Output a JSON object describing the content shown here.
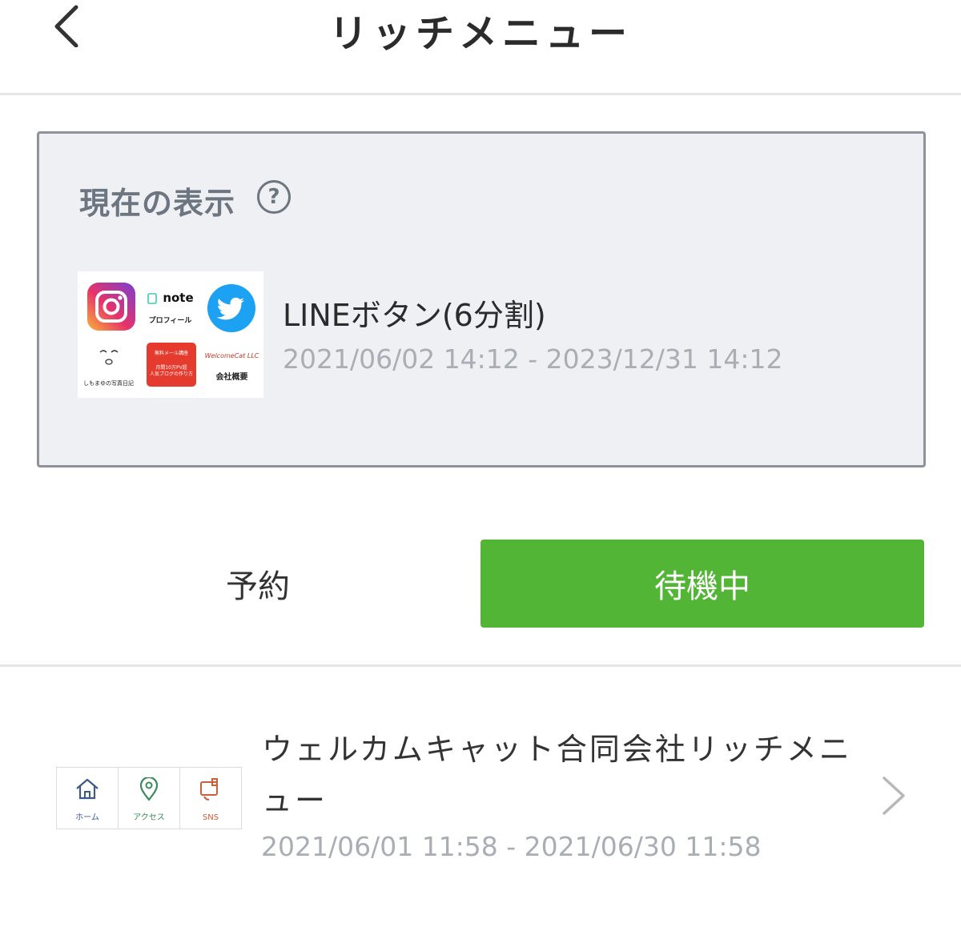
{
  "header": {
    "title": "リッチメニュー",
    "back_icon": "chevron-left-icon"
  },
  "current": {
    "label": "現在の表示",
    "help_icon_text": "?",
    "menu_name": "LINEボタン(6分割)",
    "period": "2021/06/02 14:12 - 2023/12/31 14:12",
    "thumbnail": {
      "note_label": "note",
      "note_sub": "プロフィール",
      "photo_diary": "しもまゆの写真日記",
      "red_line1": "無料メール講座",
      "red_line2": "月間10万PV超",
      "red_line3": "人気ブログの作り方",
      "company_logo": "WelcomeCat LLC",
      "company_label": "会社概要"
    }
  },
  "segments": {
    "reserve": "予約",
    "waiting": "待機中",
    "active_color": "#52b535"
  },
  "list": [
    {
      "name": "ウェルカムキャット合同会社リッチメニュー",
      "period": "2021/06/01 11:58 - 2021/06/30 11:58",
      "thumbnail": {
        "home": "ホーム",
        "access": "アクセス",
        "sns": "SNS"
      }
    }
  ]
}
